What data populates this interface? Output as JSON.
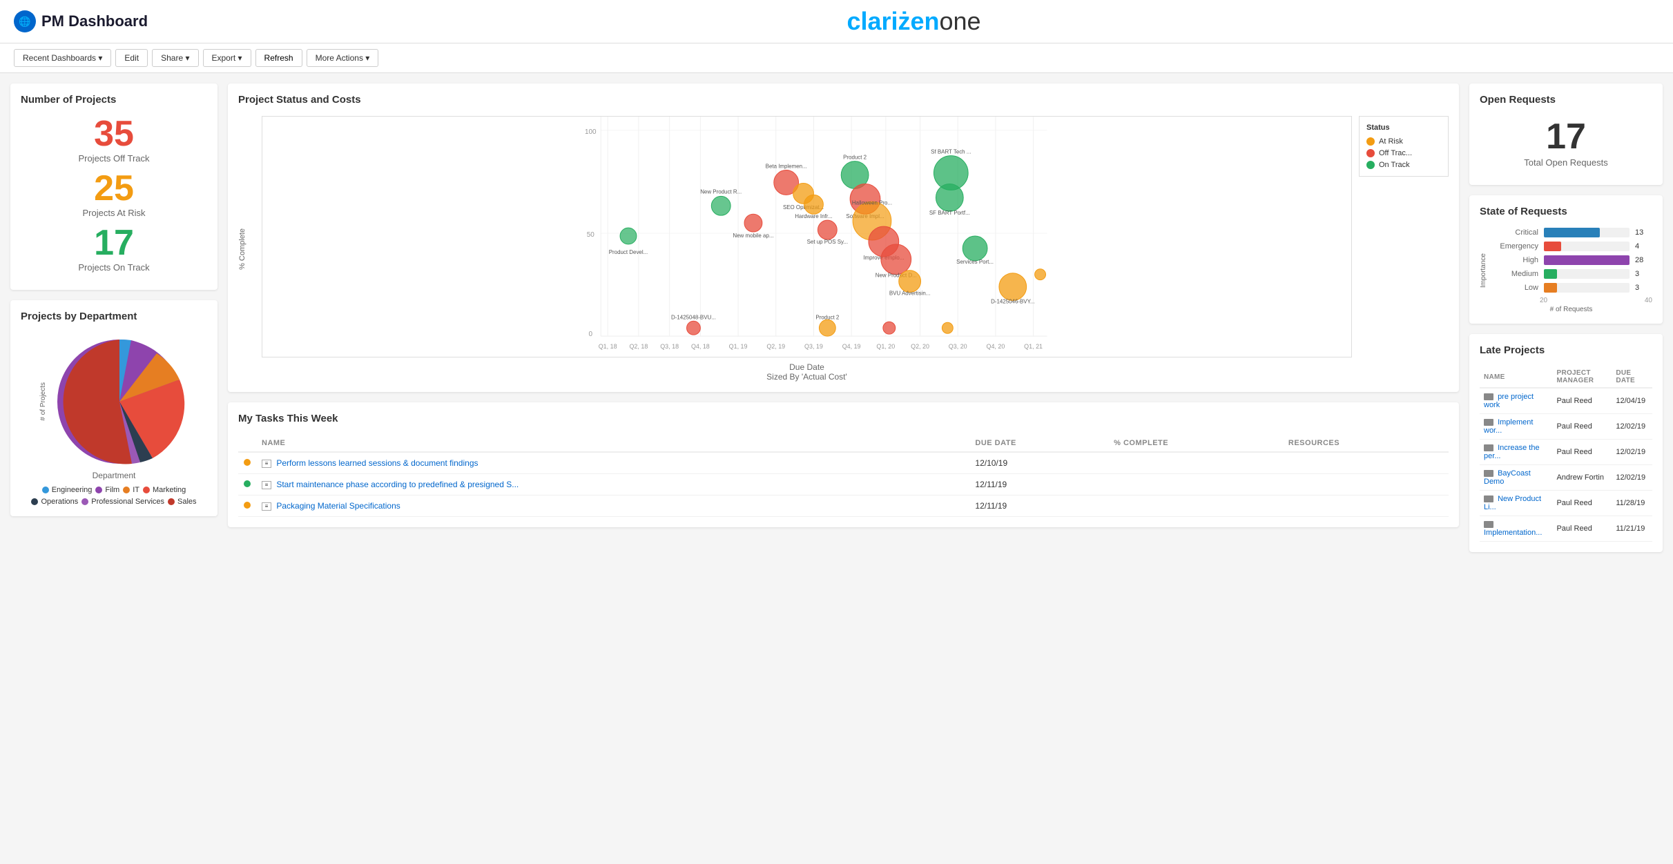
{
  "header": {
    "logo_text": "PM Dashboard",
    "brand": "clariżenone"
  },
  "toolbar": {
    "recent_dashboards": "Recent Dashboards ▾",
    "edit": "Edit",
    "share": "Share ▾",
    "export": "Export ▾",
    "refresh": "Refresh",
    "more_actions": "More Actions ▾"
  },
  "number_of_projects": {
    "title": "Number of Projects",
    "off_track": {
      "value": "35",
      "label": "Projects Off Track"
    },
    "at_risk": {
      "value": "25",
      "label": "Projects At Risk"
    },
    "on_track": {
      "value": "17",
      "label": "Projects On Track"
    }
  },
  "projects_by_dept": {
    "title": "Projects by Department",
    "y_label": "# of Projects",
    "x_label": "Department",
    "legend": [
      {
        "color": "#3498db",
        "label": "Engineering"
      },
      {
        "color": "#8e44ad",
        "label": "Film"
      },
      {
        "color": "#e67e22",
        "label": "IT"
      },
      {
        "color": "#e74c3c",
        "label": "Marketing"
      },
      {
        "color": "#2c3e50",
        "label": "Operations"
      },
      {
        "color": "#9b59b6",
        "label": "Professional Services"
      },
      {
        "color": "#c0392b",
        "label": "Sales"
      }
    ]
  },
  "project_status": {
    "title": "Project Status and Costs",
    "x_label": "Due Date",
    "x_sublabel": "Sized By 'Actual Cost'",
    "y_label": "% Complete",
    "legend": {
      "title": "Status",
      "items": [
        {
          "color": "#f39c12",
          "label": "At Risk"
        },
        {
          "color": "#e74c3c",
          "label": "Off Trac..."
        },
        {
          "color": "#27ae60",
          "label": "On Track"
        }
      ]
    },
    "bubbles": [
      {
        "x": 18,
        "y": 52,
        "r": 12,
        "color": "#27ae60",
        "label": "Product Devel..."
      },
      {
        "x": 30,
        "y": 65,
        "r": 14,
        "color": "#27ae60",
        "label": "New Product R..."
      },
      {
        "x": 38,
        "y": 72,
        "r": 18,
        "color": "#e74c3c",
        "label": "Beta Implemen..."
      },
      {
        "x": 41,
        "y": 68,
        "r": 16,
        "color": "#f39c12",
        "label": "SEO Optimizat..."
      },
      {
        "x": 42,
        "y": 60,
        "r": 15,
        "color": "#f39c12",
        "label": "Hardware Infr..."
      },
      {
        "x": 36,
        "y": 55,
        "r": 13,
        "color": "#e74c3c",
        "label": "New mobile ap..."
      },
      {
        "x": 53,
        "y": 68,
        "r": 20,
        "color": "#27ae60",
        "label": "Product 2"
      },
      {
        "x": 54,
        "y": 58,
        "r": 22,
        "color": "#e74c3c",
        "label": "Software Impl..."
      },
      {
        "x": 72,
        "y": 68,
        "r": 25,
        "color": "#27ae60",
        "label": "Sf BART Tech ..."
      },
      {
        "x": 72,
        "y": 56,
        "r": 20,
        "color": "#27ae60",
        "label": "SF BART Portf..."
      },
      {
        "x": 47,
        "y": 45,
        "r": 14,
        "color": "#e74c3c",
        "label": "Set up POS Sy..."
      },
      {
        "x": 56,
        "y": 48,
        "r": 28,
        "color": "#f39c12",
        "label": "Halloween Pro..."
      },
      {
        "x": 58,
        "y": 40,
        "r": 24,
        "color": "#e74c3c",
        "label": "Improve emplo..."
      },
      {
        "x": 60,
        "y": 32,
        "r": 22,
        "color": "#e74c3c",
        "label": "New Product D..."
      },
      {
        "x": 78,
        "y": 38,
        "r": 18,
        "color": "#27ae60",
        "label": "Services Port..."
      },
      {
        "x": 63,
        "y": 22,
        "r": 16,
        "color": "#f39c12",
        "label": "BVU Advertisin..."
      },
      {
        "x": 85,
        "y": 20,
        "r": 20,
        "color": "#f39c12",
        "label": "D-1425046-BVY..."
      },
      {
        "x": 93,
        "y": 28,
        "r": 10,
        "color": "#f39c12",
        "label": ""
      },
      {
        "x": 25,
        "y": 4,
        "r": 10,
        "color": "#e74c3c",
        "label": "D-1425048-BVU..."
      },
      {
        "x": 47,
        "y": 4,
        "r": 12,
        "color": "#f39c12",
        "label": "Product 2"
      },
      {
        "x": 60,
        "y": 6,
        "r": 10,
        "color": "#e74c3c",
        "label": ""
      },
      {
        "x": 72,
        "y": 6,
        "r": 8,
        "color": "#f39c12",
        "label": ""
      }
    ],
    "x_ticks": [
      "Q1, 18",
      "Q2, 18",
      "Q3, 18",
      "Q4, 18",
      "Q1, 19",
      "Q2, 19",
      "Q3, 19",
      "Q4, 19",
      "Q1, 20",
      "Q2, 20",
      "Q3, 20",
      "Q4, 20",
      "Q1, 21"
    ]
  },
  "my_tasks": {
    "title": "My Tasks This Week",
    "columns": [
      "",
      "NAME",
      "DUE DATE",
      "% COMPLETE",
      "RESOURCES"
    ],
    "tasks": [
      {
        "status_color": "#f39c12",
        "name": "Perform lessons learned sessions & document findings",
        "due_date": "12/10/19",
        "pct_complete": "",
        "resources": ""
      },
      {
        "status_color": "#27ae60",
        "name": "Start maintenance phase according to predefined & presigned S...",
        "due_date": "12/11/19",
        "pct_complete": "",
        "resources": ""
      },
      {
        "status_color": "#f39c12",
        "name": "Packaging Material Specifications",
        "due_date": "12/11/19",
        "pct_complete": "",
        "resources": ""
      }
    ]
  },
  "open_requests": {
    "title": "Open Requests",
    "count": "17",
    "label": "Total Open Requests"
  },
  "state_of_requests": {
    "title": "State of Requests",
    "y_label": "Importance",
    "x_label": "# of Requests",
    "x_ticks": [
      "20",
      "40"
    ],
    "items": [
      {
        "label": "Critical",
        "color": "#2980b9",
        "count": 13,
        "max": 40
      },
      {
        "label": "Emergency",
        "color": "#e74c3c",
        "count": 4,
        "max": 40
      },
      {
        "label": "High",
        "color": "#8e44ad",
        "count": 28,
        "max": 40
      },
      {
        "label": "Medium",
        "color": "#27ae60",
        "count": 3,
        "max": 40
      },
      {
        "label": "Low",
        "color": "#e67e22",
        "count": 3,
        "max": 40
      }
    ]
  },
  "late_projects": {
    "title": "Late Projects",
    "columns": [
      "NAME",
      "PROJECT MANAGER",
      "DUE DATE"
    ],
    "projects": [
      {
        "name": "pre project work",
        "manager": "Paul Reed",
        "due": "12/04/19"
      },
      {
        "name": "Implement wor...",
        "manager": "Paul Reed",
        "due": "12/02/19"
      },
      {
        "name": "Increase the per...",
        "manager": "Paul Reed",
        "due": "12/02/19"
      },
      {
        "name": "BayCoast Demo",
        "manager": "Andrew Fortin",
        "due": "12/02/19"
      },
      {
        "name": "New Product Li...",
        "manager": "Paul Reed",
        "due": "11/28/19"
      },
      {
        "name": "Implementation...",
        "manager": "Paul Reed",
        "due": "11/21/19"
      }
    ]
  }
}
